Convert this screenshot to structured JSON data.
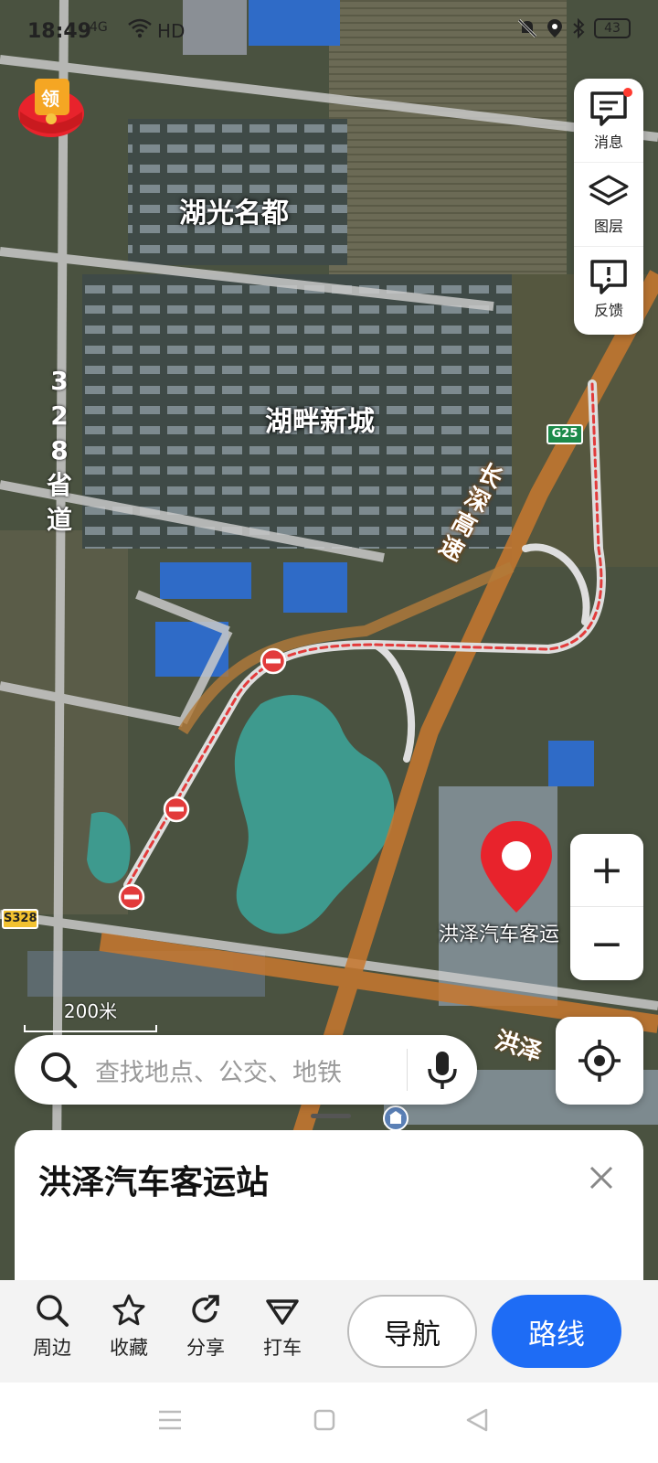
{
  "status_bar": {
    "time": "18:49",
    "signal": "4G",
    "network": "HD",
    "battery": "43"
  },
  "map": {
    "labels": [
      {
        "text": "湖光名都"
      },
      {
        "text": "湖畔新城"
      },
      {
        "text": "3"
      },
      {
        "text": "2"
      },
      {
        "text": "8"
      },
      {
        "text": "省"
      },
      {
        "text": "道"
      },
      {
        "text": "长"
      },
      {
        "text": "深"
      },
      {
        "text": "高"
      },
      {
        "text": "速"
      },
      {
        "text": "洪泽"
      }
    ],
    "shields": {
      "g25": "G25",
      "s328": "S328"
    },
    "poi_label": "洪泽汽车客运",
    "scale": "200米"
  },
  "redpack": {
    "label": "领"
  },
  "right_panel": {
    "messages": "消息",
    "layers": "图层",
    "feedback": "反馈"
  },
  "zoom": {
    "in": "+",
    "out": "−"
  },
  "search": {
    "placeholder": "查找地点、公交、地铁"
  },
  "card": {
    "title": "洪泽汽车客运站"
  },
  "actions": {
    "nearby": "周边",
    "favorite": "收藏",
    "share": "分享",
    "taxi": "打车",
    "navigate": "导航",
    "route": "路线"
  },
  "colors": {
    "accent": "#1e6cf5",
    "pin": "#e8232c",
    "route_dash": "#e23b3b"
  }
}
